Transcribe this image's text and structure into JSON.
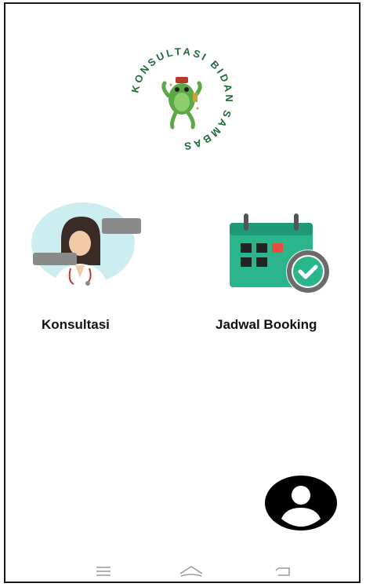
{
  "logo": {
    "ring_text": "KONSULTASI BIDAN SAMBAS",
    "icon": "frog-mascot-icon"
  },
  "menu": [
    {
      "label": "Konsultasi",
      "icon": "doctor-avatar-icon"
    },
    {
      "label": "Jadwal Booking",
      "icon": "calendar-check-icon"
    }
  ],
  "profile": {
    "icon": "account-circle-icon"
  },
  "navbar": {
    "icons": [
      "recent-apps-icon",
      "home-icon",
      "back-icon"
    ]
  },
  "colors": {
    "brand_green": "#1f6b3a",
    "calendar_green": "#2bb58a",
    "calendar_red": "#e74c3c",
    "check_green": "#2bb58a",
    "text": "#111111"
  }
}
